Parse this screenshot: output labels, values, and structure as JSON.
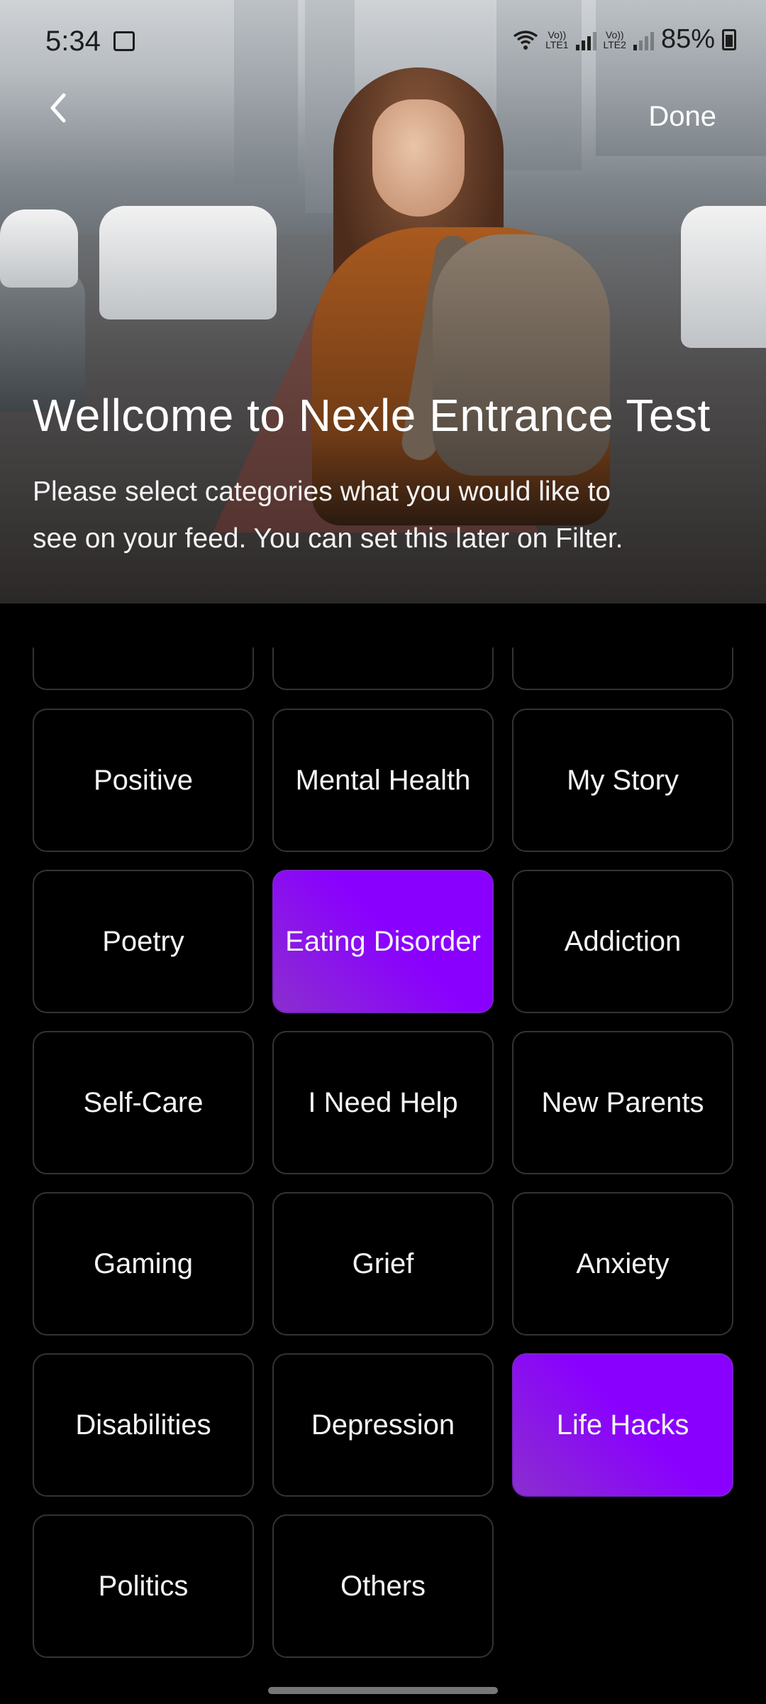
{
  "status_bar": {
    "time": "5:34",
    "network_1": "Vo))\nLTE1",
    "network_2": "Vo))\nLTE2",
    "battery_percent": "85%"
  },
  "header": {
    "back_icon": "chevron-left-icon",
    "done_label": "Done"
  },
  "intro": {
    "title": "Wellcome to Nexle Entrance Test",
    "subtitle": "Please select categories what you would like to see on your feed. You can set this later on Filter."
  },
  "colors": {
    "selected_accent": "#8A00FF",
    "cell_border": "#333333",
    "background": "#000000"
  },
  "categories": [
    {
      "label": "",
      "selected": false
    },
    {
      "label": "",
      "selected": false
    },
    {
      "label": "",
      "selected": false
    },
    {
      "label": "Positive",
      "selected": false
    },
    {
      "label": "Mental Health",
      "selected": false
    },
    {
      "label": "My Story",
      "selected": false
    },
    {
      "label": "Poetry",
      "selected": false
    },
    {
      "label": "Eating Disorder",
      "selected": true
    },
    {
      "label": "Addiction",
      "selected": false
    },
    {
      "label": "Self-Care",
      "selected": false
    },
    {
      "label": "I Need Help",
      "selected": false
    },
    {
      "label": "New Parents",
      "selected": false
    },
    {
      "label": "Gaming",
      "selected": false
    },
    {
      "label": "Grief",
      "selected": false
    },
    {
      "label": "Anxiety",
      "selected": false
    },
    {
      "label": "Disabilities",
      "selected": false
    },
    {
      "label": "Depression",
      "selected": false
    },
    {
      "label": "Life Hacks",
      "selected": true
    },
    {
      "label": "Politics",
      "selected": false
    },
    {
      "label": "Others",
      "selected": false
    }
  ]
}
